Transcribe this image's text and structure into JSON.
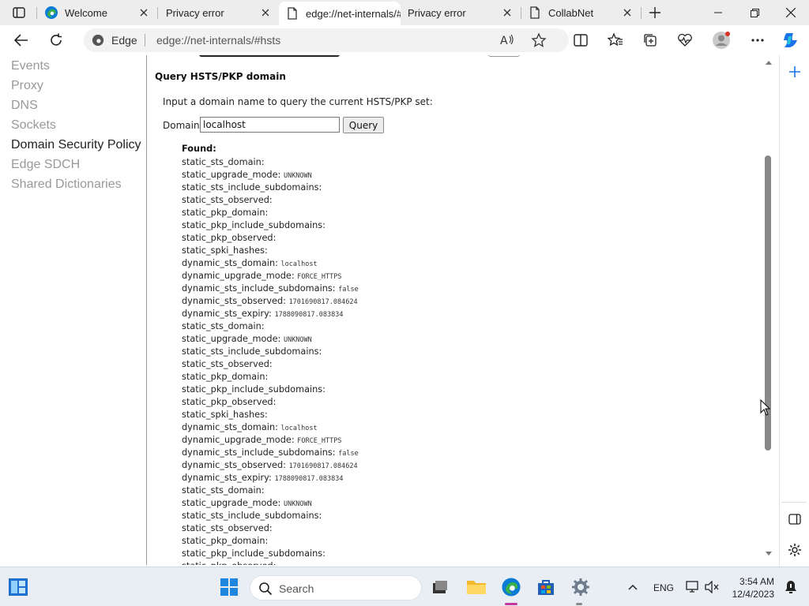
{
  "tabs": [
    {
      "label": "Welcome",
      "icon": "edge-icon"
    },
    {
      "label": "Privacy error",
      "icon": "none"
    },
    {
      "label": "edge://net-internals/#hsts",
      "icon": "page-icon",
      "active": true
    },
    {
      "label": "Privacy error",
      "icon": "none"
    },
    {
      "label": "CollabNet",
      "icon": "page-icon"
    }
  ],
  "address": {
    "site_label": "Edge",
    "url": "edge://net-internals/#hsts"
  },
  "sidebar": {
    "items": [
      {
        "label": "Events",
        "active": false
      },
      {
        "label": "Proxy",
        "active": false
      },
      {
        "label": "DNS",
        "active": false
      },
      {
        "label": "Sockets",
        "active": false
      },
      {
        "label": "Domain Security Policy",
        "active": true
      },
      {
        "label": "Edge SDCH",
        "active": false
      },
      {
        "label": "Shared Dictionaries",
        "active": false
      }
    ]
  },
  "query": {
    "title": "Query HSTS/PKP domain",
    "description": "Input a domain name to query the current HSTS/PKP set:",
    "domain_label": "Domain:",
    "domain_value": "localhost",
    "button_label": "Query",
    "found_label": "Found:"
  },
  "results": [
    {
      "k": "static_sts_domain:",
      "v": ""
    },
    {
      "k": "static_upgrade_mode:",
      "v": "UNKNOWN"
    },
    {
      "k": "static_sts_include_subdomains:",
      "v": ""
    },
    {
      "k": "static_sts_observed:",
      "v": ""
    },
    {
      "k": "static_pkp_domain:",
      "v": ""
    },
    {
      "k": "static_pkp_include_subdomains:",
      "v": ""
    },
    {
      "k": "static_pkp_observed:",
      "v": ""
    },
    {
      "k": "static_spki_hashes:",
      "v": ""
    },
    {
      "k": "dynamic_sts_domain:",
      "v": "localhost"
    },
    {
      "k": "dynamic_upgrade_mode:",
      "v": "FORCE_HTTPS"
    },
    {
      "k": "dynamic_sts_include_subdomains:",
      "v": "false"
    },
    {
      "k": "dynamic_sts_observed:",
      "v": "1701690817.084624"
    },
    {
      "k": "dynamic_sts_expiry:",
      "v": "1788090817.083834"
    },
    {
      "k": "static_sts_domain:",
      "v": ""
    },
    {
      "k": "static_upgrade_mode:",
      "v": "UNKNOWN"
    },
    {
      "k": "static_sts_include_subdomains:",
      "v": ""
    },
    {
      "k": "static_sts_observed:",
      "v": ""
    },
    {
      "k": "static_pkp_domain:",
      "v": ""
    },
    {
      "k": "static_pkp_include_subdomains:",
      "v": ""
    },
    {
      "k": "static_pkp_observed:",
      "v": ""
    },
    {
      "k": "static_spki_hashes:",
      "v": ""
    },
    {
      "k": "dynamic_sts_domain:",
      "v": "localhost"
    },
    {
      "k": "dynamic_upgrade_mode:",
      "v": "FORCE_HTTPS"
    },
    {
      "k": "dynamic_sts_include_subdomains:",
      "v": "false"
    },
    {
      "k": "dynamic_sts_observed:",
      "v": "1701690817.084624"
    },
    {
      "k": "dynamic_sts_expiry:",
      "v": "1788090817.083834"
    },
    {
      "k": "static_sts_domain:",
      "v": ""
    },
    {
      "k": "static_upgrade_mode:",
      "v": "UNKNOWN"
    },
    {
      "k": "static_sts_include_subdomains:",
      "v": ""
    },
    {
      "k": "static_sts_observed:",
      "v": ""
    },
    {
      "k": "static_pkp_domain:",
      "v": ""
    },
    {
      "k": "static_pkp_include_subdomains:",
      "v": ""
    },
    {
      "k": "static_pkp_observed:",
      "v": ""
    }
  ],
  "taskbar": {
    "search_label": "Search",
    "language": "ENG",
    "time": "3:54 AM",
    "date": "12/4/2023"
  },
  "colors": {
    "tab_strip": "#ededed",
    "accent_copilot": "#1a73e8",
    "edge_blue": "#0c7bd6",
    "edge_green": "#3ab04a",
    "taskbar": "#e9eef5"
  }
}
